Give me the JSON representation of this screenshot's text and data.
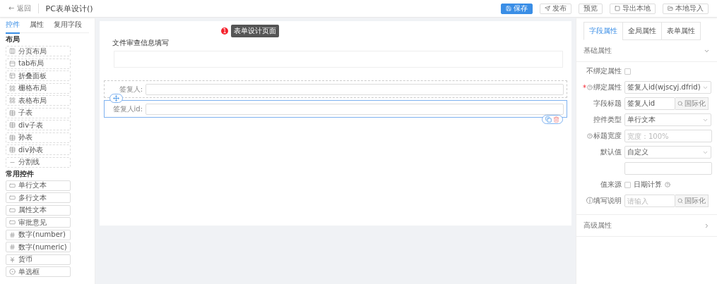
{
  "header": {
    "back": "← 返回",
    "title": "PC表单设计()",
    "actions": [
      {
        "label": "保存",
        "kind": "primary"
      },
      {
        "label": "发布",
        "kind": "default"
      },
      {
        "label": "预览",
        "kind": "default"
      },
      {
        "label": "导出本地",
        "kind": "default"
      },
      {
        "label": "本地导入",
        "kind": "default"
      }
    ]
  },
  "left_tabs": [
    {
      "label": "控件",
      "selected": true
    },
    {
      "label": "属性",
      "selected": false
    },
    {
      "label": "复用字段",
      "selected": false
    }
  ],
  "groups": [
    {
      "title": "布局",
      "kind": "layout",
      "items": [
        "分页布局",
        "tab布局",
        "折叠面板",
        "栅格布局",
        "表格布局",
        "子表",
        "div子表",
        "孙表",
        "div孙表",
        "分割线"
      ]
    },
    {
      "title": "常用控件",
      "kind": "controls",
      "items": [
        "单行文本",
        "多行文本",
        "属性文本",
        "审批意见",
        "数字(number)",
        "数字(numeric)",
        "货币",
        "单选框"
      ]
    }
  ],
  "canvas": {
    "badge": "1",
    "tooltip": "表单设计页面",
    "section_title": "文件审查信息填写",
    "fields": [
      {
        "label": "签复人:",
        "selected": false
      },
      {
        "label": "签复人id:",
        "selected": true
      }
    ]
  },
  "right_tabs": [
    {
      "label": "字段属性",
      "selected": true
    },
    {
      "label": "全局属性",
      "selected": false
    },
    {
      "label": "表单属性",
      "selected": false
    }
  ],
  "basic": {
    "title": "基础属性",
    "expanded": true,
    "rows": [
      {
        "kind": "checkbox",
        "label": "不绑定属性",
        "checked": false
      },
      {
        "kind": "select",
        "mark": "*",
        "help": true,
        "label": "绑定属性",
        "value": "签复人id(wjscyj.dfrid)"
      },
      {
        "kind": "i18n",
        "label": "字段标题",
        "value": "签复人id",
        "button": "国际化"
      },
      {
        "kind": "select",
        "label": "控件类型",
        "value": "单行文本"
      },
      {
        "kind": "input",
        "help": true,
        "label": "标题宽度",
        "placeholder": "宽度：100%"
      },
      {
        "kind": "select",
        "label": "默认值",
        "value": "自定义"
      },
      {
        "kind": "input"
      },
      {
        "kind": "checkbox",
        "label": "值来源",
        "checked": false,
        "text": "日期计算",
        "text_help": true
      },
      {
        "kind": "i18n",
        "label": "ⓘ填写说明",
        "placeholder": "请输入",
        "button": "国际化"
      }
    ]
  },
  "advanced": {
    "title": "高级属性",
    "expanded": false
  }
}
